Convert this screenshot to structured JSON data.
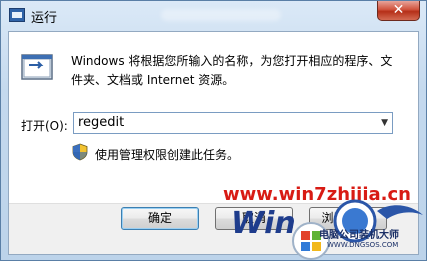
{
  "window": {
    "title": "运行",
    "close_label": "✕"
  },
  "dialog": {
    "description": "Windows 将根据您所输入的名称，为您打开相应的程序、文件夹、文档或 Internet 资源。",
    "open_label": "打开(O):",
    "open_value": "regedit",
    "admin_note": "使用管理权限创建此任务。"
  },
  "buttons": {
    "ok": "确定",
    "cancel": "取消",
    "browse": "浏览(B)..."
  },
  "watermark": {
    "url": "www.win7zhijia.cn",
    "brand": "电脑公司装机大师",
    "brand_url": "WWW.DNGSOS.COM"
  },
  "colors": {
    "watermark_red": "#d81b14",
    "brand_blue": "#1a2f66"
  }
}
